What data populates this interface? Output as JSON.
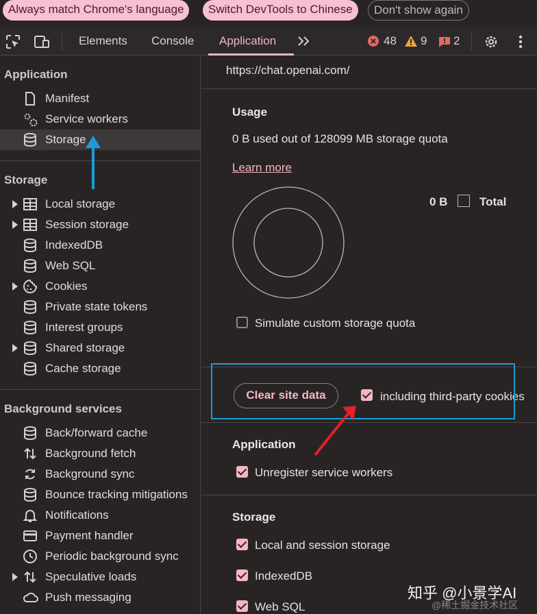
{
  "lang_bar": {
    "match_label": "Always match Chrome's language",
    "switch_label": "Switch DevTools to Chinese",
    "dont_show_label": "Don't show again"
  },
  "toolbar": {
    "tabs": [
      "Elements",
      "Console",
      "Application"
    ],
    "active_tab": "Application",
    "more_tabs_icon": "double-chevron-right",
    "error_count": "48",
    "warning_count": "9",
    "issue_count": "2"
  },
  "sidebar": {
    "application_heading": "Application",
    "application_items": [
      {
        "label": "Manifest",
        "icon": "document-icon"
      },
      {
        "label": "Service workers",
        "icon": "gears-icon"
      },
      {
        "label": "Storage",
        "icon": "database-icon",
        "selected": true
      }
    ],
    "storage_heading": "Storage",
    "storage_items": [
      {
        "label": "Local storage",
        "icon": "table-icon",
        "expandable": true
      },
      {
        "label": "Session storage",
        "icon": "table-icon",
        "expandable": true
      },
      {
        "label": "IndexedDB",
        "icon": "database-icon"
      },
      {
        "label": "Web SQL",
        "icon": "database-icon"
      },
      {
        "label": "Cookies",
        "icon": "cookie-icon",
        "expandable": true
      },
      {
        "label": "Private state tokens",
        "icon": "database-icon"
      },
      {
        "label": "Interest groups",
        "icon": "database-icon"
      },
      {
        "label": "Shared storage",
        "icon": "database-icon",
        "expandable": true
      },
      {
        "label": "Cache storage",
        "icon": "database-icon"
      }
    ],
    "background_heading": "Background services",
    "background_items": [
      {
        "label": "Back/forward cache",
        "icon": "database-icon"
      },
      {
        "label": "Background fetch",
        "icon": "up-down-arrows-icon"
      },
      {
        "label": "Background sync",
        "icon": "sync-icon"
      },
      {
        "label": "Bounce tracking mitigations",
        "icon": "database-icon"
      },
      {
        "label": "Notifications",
        "icon": "bell-icon"
      },
      {
        "label": "Payment handler",
        "icon": "card-icon"
      },
      {
        "label": "Periodic background sync",
        "icon": "clock-icon"
      },
      {
        "label": "Speculative loads",
        "icon": "up-down-arrows-icon",
        "expandable": true
      },
      {
        "label": "Push messaging",
        "icon": "cloud-icon"
      }
    ]
  },
  "main": {
    "origin": "https://chat.openai.com/",
    "usage_heading": "Usage",
    "usage_text": "0 B used out of 128099 MB storage quota",
    "learn_more": "Learn more",
    "legend_value": "0 B",
    "legend_label": "Total",
    "simulate_label": "Simulate custom storage quota",
    "clear_button": "Clear site data",
    "third_party_label": "including third-party cookies",
    "application_heading": "Application",
    "unregister_label": "Unregister service workers",
    "storage_heading": "Storage",
    "storage_options": [
      "Local and session storage",
      "IndexedDB",
      "Web SQL"
    ]
  },
  "watermark": {
    "zhihu": "知乎 @小景学AI",
    "juejin": "@稀土掘金技术社区"
  },
  "colors": {
    "accent_pink": "#f5b6c6",
    "annotation_blue": "#1e9bd7",
    "annotation_red": "#e0212b",
    "background": "#282424"
  }
}
